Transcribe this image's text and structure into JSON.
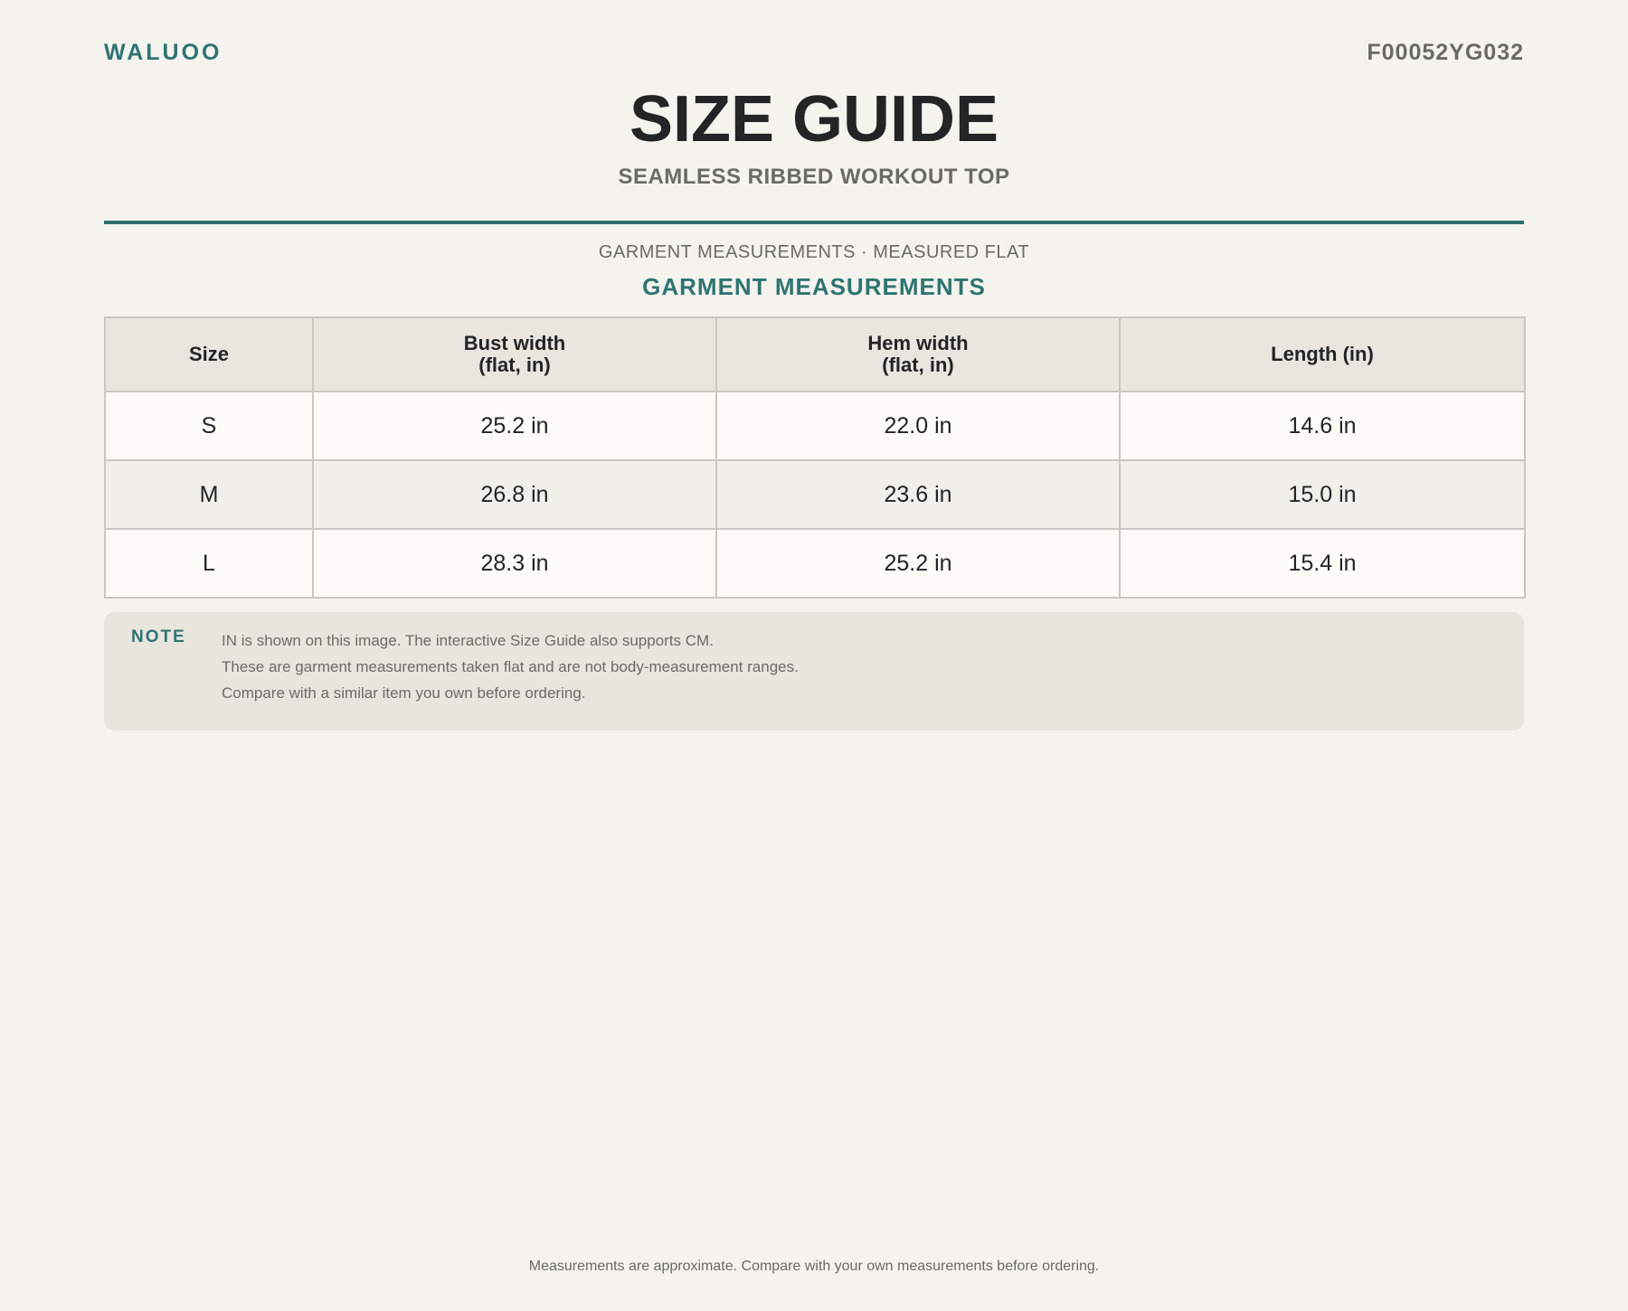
{
  "header": {
    "brand": "WALUOO",
    "sku": "F00052YG032",
    "title": "SIZE GUIDE",
    "subtitle": "SEAMLESS RIBBED WORKOUT TOP"
  },
  "section": {
    "label": "GARMENT MEASUREMENTS · MEASURED FLAT",
    "heading": "GARMENT MEASUREMENTS"
  },
  "table": {
    "columns": [
      {
        "line1": "Size",
        "line2": ""
      },
      {
        "line1": "Bust width",
        "line2": "(flat, in)"
      },
      {
        "line1": "Hem width",
        "line2": "(flat, in)"
      },
      {
        "line1": "Length (in)",
        "line2": ""
      }
    ],
    "rows": [
      [
        "S",
        "25.2 in",
        "22.0 in",
        "14.6 in"
      ],
      [
        "M",
        "26.8 in",
        "23.6 in",
        "15.0 in"
      ],
      [
        "L",
        "28.3 in",
        "25.2 in",
        "15.4 in"
      ]
    ]
  },
  "note": {
    "label": "NOTE",
    "lines": [
      "IN is shown on this image. The interactive Size Guide also supports CM.",
      "These are garment measurements taken flat and are not body-measurement ranges.",
      "Compare with a similar item you own before ordering."
    ]
  },
  "footer": {
    "text": "Measurements are approximate. Compare with your own measurements before ordering."
  },
  "colors": {
    "accent": "#2f7471",
    "background": "#f4f3ee",
    "text": "#222426",
    "muted": "#6b6b66"
  }
}
